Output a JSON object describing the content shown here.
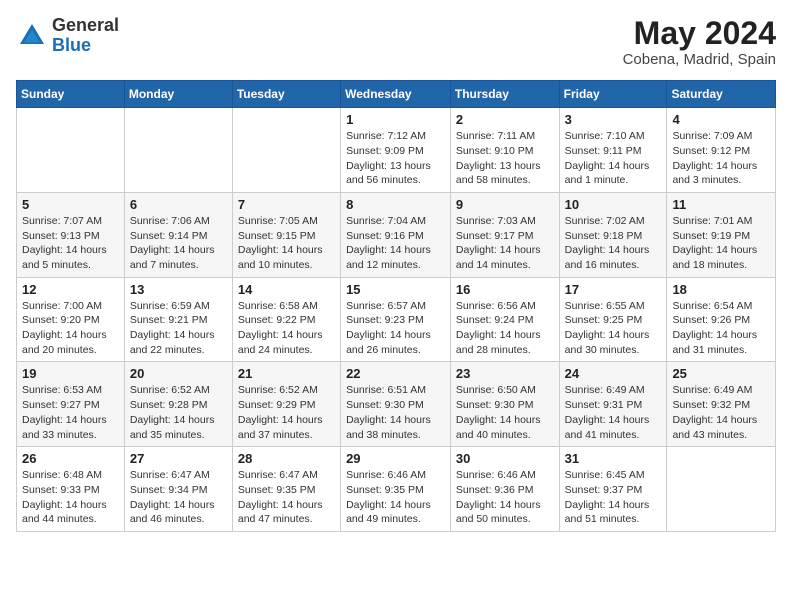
{
  "header": {
    "logo_general": "General",
    "logo_blue": "Blue",
    "month_title": "May 2024",
    "location": "Cobena, Madrid, Spain"
  },
  "weekdays": [
    "Sunday",
    "Monday",
    "Tuesday",
    "Wednesday",
    "Thursday",
    "Friday",
    "Saturday"
  ],
  "weeks": [
    [
      {
        "day": "",
        "info": ""
      },
      {
        "day": "",
        "info": ""
      },
      {
        "day": "",
        "info": ""
      },
      {
        "day": "1",
        "info": "Sunrise: 7:12 AM\nSunset: 9:09 PM\nDaylight: 13 hours and 56 minutes."
      },
      {
        "day": "2",
        "info": "Sunrise: 7:11 AM\nSunset: 9:10 PM\nDaylight: 13 hours and 58 minutes."
      },
      {
        "day": "3",
        "info": "Sunrise: 7:10 AM\nSunset: 9:11 PM\nDaylight: 14 hours and 1 minute."
      },
      {
        "day": "4",
        "info": "Sunrise: 7:09 AM\nSunset: 9:12 PM\nDaylight: 14 hours and 3 minutes."
      }
    ],
    [
      {
        "day": "5",
        "info": "Sunrise: 7:07 AM\nSunset: 9:13 PM\nDaylight: 14 hours and 5 minutes."
      },
      {
        "day": "6",
        "info": "Sunrise: 7:06 AM\nSunset: 9:14 PM\nDaylight: 14 hours and 7 minutes."
      },
      {
        "day": "7",
        "info": "Sunrise: 7:05 AM\nSunset: 9:15 PM\nDaylight: 14 hours and 10 minutes."
      },
      {
        "day": "8",
        "info": "Sunrise: 7:04 AM\nSunset: 9:16 PM\nDaylight: 14 hours and 12 minutes."
      },
      {
        "day": "9",
        "info": "Sunrise: 7:03 AM\nSunset: 9:17 PM\nDaylight: 14 hours and 14 minutes."
      },
      {
        "day": "10",
        "info": "Sunrise: 7:02 AM\nSunset: 9:18 PM\nDaylight: 14 hours and 16 minutes."
      },
      {
        "day": "11",
        "info": "Sunrise: 7:01 AM\nSunset: 9:19 PM\nDaylight: 14 hours and 18 minutes."
      }
    ],
    [
      {
        "day": "12",
        "info": "Sunrise: 7:00 AM\nSunset: 9:20 PM\nDaylight: 14 hours and 20 minutes."
      },
      {
        "day": "13",
        "info": "Sunrise: 6:59 AM\nSunset: 9:21 PM\nDaylight: 14 hours and 22 minutes."
      },
      {
        "day": "14",
        "info": "Sunrise: 6:58 AM\nSunset: 9:22 PM\nDaylight: 14 hours and 24 minutes."
      },
      {
        "day": "15",
        "info": "Sunrise: 6:57 AM\nSunset: 9:23 PM\nDaylight: 14 hours and 26 minutes."
      },
      {
        "day": "16",
        "info": "Sunrise: 6:56 AM\nSunset: 9:24 PM\nDaylight: 14 hours and 28 minutes."
      },
      {
        "day": "17",
        "info": "Sunrise: 6:55 AM\nSunset: 9:25 PM\nDaylight: 14 hours and 30 minutes."
      },
      {
        "day": "18",
        "info": "Sunrise: 6:54 AM\nSunset: 9:26 PM\nDaylight: 14 hours and 31 minutes."
      }
    ],
    [
      {
        "day": "19",
        "info": "Sunrise: 6:53 AM\nSunset: 9:27 PM\nDaylight: 14 hours and 33 minutes."
      },
      {
        "day": "20",
        "info": "Sunrise: 6:52 AM\nSunset: 9:28 PM\nDaylight: 14 hours and 35 minutes."
      },
      {
        "day": "21",
        "info": "Sunrise: 6:52 AM\nSunset: 9:29 PM\nDaylight: 14 hours and 37 minutes."
      },
      {
        "day": "22",
        "info": "Sunrise: 6:51 AM\nSunset: 9:30 PM\nDaylight: 14 hours and 38 minutes."
      },
      {
        "day": "23",
        "info": "Sunrise: 6:50 AM\nSunset: 9:30 PM\nDaylight: 14 hours and 40 minutes."
      },
      {
        "day": "24",
        "info": "Sunrise: 6:49 AM\nSunset: 9:31 PM\nDaylight: 14 hours and 41 minutes."
      },
      {
        "day": "25",
        "info": "Sunrise: 6:49 AM\nSunset: 9:32 PM\nDaylight: 14 hours and 43 minutes."
      }
    ],
    [
      {
        "day": "26",
        "info": "Sunrise: 6:48 AM\nSunset: 9:33 PM\nDaylight: 14 hours and 44 minutes."
      },
      {
        "day": "27",
        "info": "Sunrise: 6:47 AM\nSunset: 9:34 PM\nDaylight: 14 hours and 46 minutes."
      },
      {
        "day": "28",
        "info": "Sunrise: 6:47 AM\nSunset: 9:35 PM\nDaylight: 14 hours and 47 minutes."
      },
      {
        "day": "29",
        "info": "Sunrise: 6:46 AM\nSunset: 9:35 PM\nDaylight: 14 hours and 49 minutes."
      },
      {
        "day": "30",
        "info": "Sunrise: 6:46 AM\nSunset: 9:36 PM\nDaylight: 14 hours and 50 minutes."
      },
      {
        "day": "31",
        "info": "Sunrise: 6:45 AM\nSunset: 9:37 PM\nDaylight: 14 hours and 51 minutes."
      },
      {
        "day": "",
        "info": ""
      }
    ]
  ]
}
